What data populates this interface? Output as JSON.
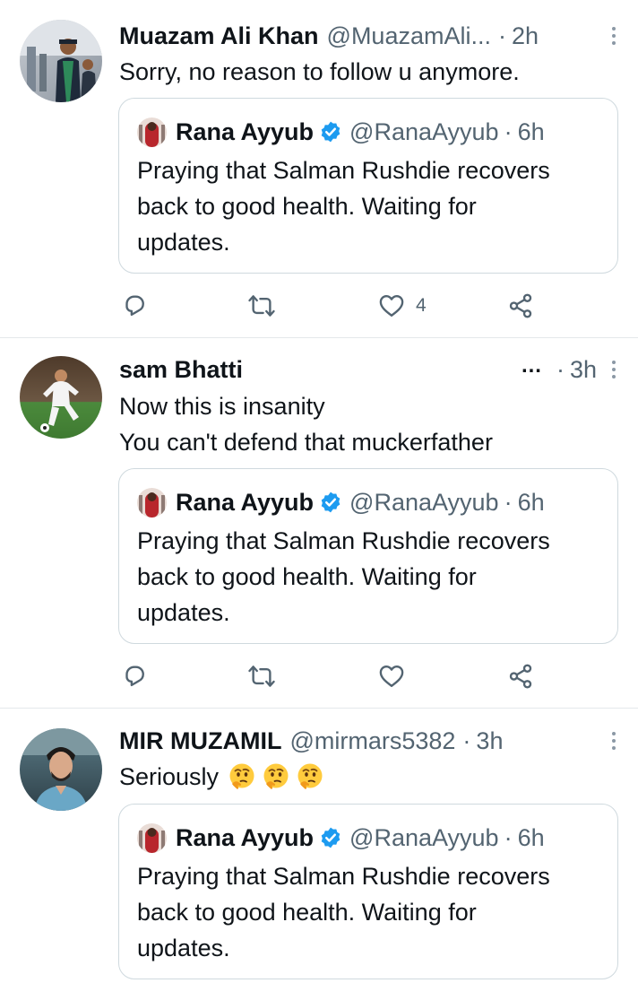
{
  "quoted_tweet": {
    "author": "Rana Ayyub",
    "handle": "@RanaAyyub",
    "time": "6h",
    "text_lines": [
      "Praying that Salman Rushdie recovers",
      "back to good health. Waiting for",
      "updates."
    ]
  },
  "replies": [
    {
      "author": "Muazam Ali Khan",
      "handle": "@MuazamAli...",
      "time": "2h",
      "text_lines": [
        "Sorry, no reason to follow u anymore."
      ],
      "like_count": "4"
    },
    {
      "author": "sam Bhatti",
      "handle_truncated": "...",
      "time": "3h",
      "text_lines": [
        "Now this is insanity",
        "You can't defend that muckerfather"
      ]
    },
    {
      "author": "MIR MUZAMIL",
      "handle": "@mirmars5382",
      "time": "3h",
      "text_lines": [
        "Seriously"
      ],
      "emojis": [
        "thinking-face",
        "thinking-face",
        "thinking-face"
      ]
    }
  ],
  "separator": "·",
  "icons": {
    "reply": "reply-icon",
    "retweet": "retweet-icon",
    "like": "heart-icon",
    "share": "share-icon",
    "more": "more-options-icon",
    "verified": "verified-badge-icon"
  },
  "colors": {
    "text": "#0f1419",
    "secondary": "#536471",
    "verified": "#1d9bf0",
    "border": "#cfd9de",
    "divider": "#e4e8eb"
  }
}
